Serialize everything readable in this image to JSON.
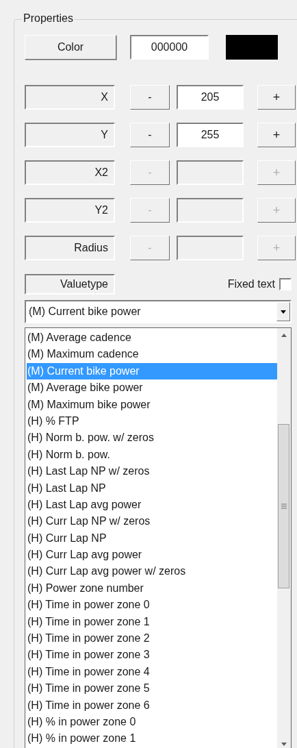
{
  "group": {
    "title": "Properties"
  },
  "color": {
    "button": "Color",
    "hex": "000000"
  },
  "rows": [
    {
      "label": "X",
      "minus": "-",
      "value": "205",
      "plus": "+",
      "disabled": false
    },
    {
      "label": "Y",
      "minus": "-",
      "value": "255",
      "plus": "+",
      "disabled": false
    },
    {
      "label": "X2",
      "minus": "-",
      "plus": "+",
      "disabled": true
    },
    {
      "label": "Y2",
      "minus": "-",
      "plus": "+",
      "disabled": true
    },
    {
      "label": "Radius",
      "minus": "-",
      "plus": "+",
      "disabled": true
    }
  ],
  "valuetype": {
    "label": "Valuetype",
    "fixed_text": {
      "label": "Fixed text",
      "checked": false
    }
  },
  "combo": {
    "value": "(M) Current bike power"
  },
  "list": [
    {
      "label": "(M) Average cadence",
      "selected": false
    },
    {
      "label": "(M) Maximum cadence",
      "selected": false
    },
    {
      "label": "(M) Current bike power",
      "selected": true
    },
    {
      "label": "(M) Average bike power",
      "selected": false
    },
    {
      "label": "(M) Maximum bike power",
      "selected": false
    },
    {
      "label": "(H) % FTP",
      "selected": false
    },
    {
      "label": "(H) Norm b. pow. w/ zeros",
      "selected": false
    },
    {
      "label": "(H) Norm b. pow.",
      "selected": false
    },
    {
      "label": "(H) Last Lap NP w/ zeros",
      "selected": false
    },
    {
      "label": "(H) Last Lap NP",
      "selected": false
    },
    {
      "label": "(H) Last Lap avg power",
      "selected": false
    },
    {
      "label": "(H) Curr Lap NP w/ zeros",
      "selected": false
    },
    {
      "label": "(H) Curr Lap NP",
      "selected": false
    },
    {
      "label": "(H) Curr Lap avg power",
      "selected": false
    },
    {
      "label": "(H) Curr Lap avg power w/ zeros",
      "selected": false
    },
    {
      "label": "(H) Power zone number",
      "selected": false
    },
    {
      "label": "(H) Time in power zone 0",
      "selected": false
    },
    {
      "label": "(H) Time in power zone 1",
      "selected": false
    },
    {
      "label": "(H) Time in power zone 2",
      "selected": false
    },
    {
      "label": "(H) Time in power zone 3",
      "selected": false
    },
    {
      "label": "(H) Time in power zone 4",
      "selected": false
    },
    {
      "label": "(H) Time in power zone 5",
      "selected": false
    },
    {
      "label": "(H) Time in power zone 6",
      "selected": false
    },
    {
      "label": "(H) % in power zone 0",
      "selected": false
    },
    {
      "label": "(H) % in power zone 1",
      "selected": false
    }
  ]
}
